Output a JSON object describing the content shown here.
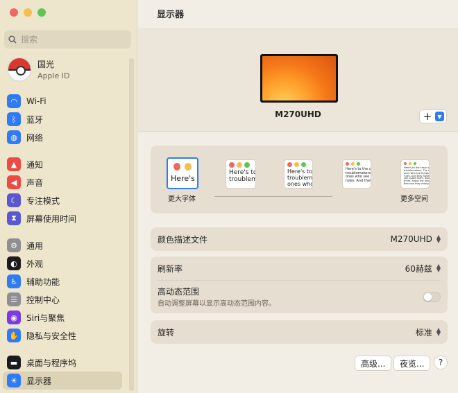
{
  "window": {
    "title": "显示器"
  },
  "search": {
    "placeholder": "搜索"
  },
  "profile": {
    "name": "国光",
    "subtitle": "Apple ID"
  },
  "sidebar": {
    "groups": [
      [
        {
          "label": "Wi-Fi",
          "icon": "wifi-icon",
          "color": "#2f7bf5",
          "glyph": "◠"
        },
        {
          "label": "蓝牙",
          "icon": "bluetooth-icon",
          "color": "#2f7bf5",
          "glyph": "ᛒ"
        },
        {
          "label": "网络",
          "icon": "globe-icon",
          "color": "#2f7bf5",
          "glyph": "◍"
        }
      ],
      [
        {
          "label": "通知",
          "icon": "bell-icon",
          "color": "#ec4b44",
          "glyph": "▲"
        },
        {
          "label": "声音",
          "icon": "speaker-icon",
          "color": "#ec4b44",
          "glyph": "◀"
        },
        {
          "label": "专注模式",
          "icon": "moon-icon",
          "color": "#5b57d1",
          "glyph": "☾"
        },
        {
          "label": "屏幕使用时间",
          "icon": "hourglass-icon",
          "color": "#5b57d1",
          "glyph": "⧗"
        }
      ],
      [
        {
          "label": "通用",
          "icon": "gear-icon",
          "color": "#8e8e93",
          "glyph": "⚙"
        },
        {
          "label": "外观",
          "icon": "appearance-icon",
          "color": "#1c1c1e",
          "glyph": "◐"
        },
        {
          "label": "辅助功能",
          "icon": "accessibility-icon",
          "color": "#2f7bf5",
          "glyph": "♿"
        },
        {
          "label": "控制中心",
          "icon": "control-center-icon",
          "color": "#8e8e93",
          "glyph": "☰"
        },
        {
          "label": "Siri与聚焦",
          "icon": "siri-icon",
          "color": "#7a3ce0",
          "glyph": "◉"
        },
        {
          "label": "隐私与安全性",
          "icon": "hand-icon",
          "color": "#2f7bf5",
          "glyph": "✋"
        }
      ],
      [
        {
          "label": "桌面与程序坞",
          "icon": "dock-icon",
          "color": "#1c1c1e",
          "glyph": "▬"
        },
        {
          "label": "显示器",
          "icon": "display-icon",
          "color": "#2f7bf5",
          "glyph": "☀",
          "active": true
        }
      ]
    ]
  },
  "display": {
    "name": "M270UHD",
    "add_label": "+"
  },
  "resolution": {
    "left_label": "更大字体",
    "right_label": "更多空间",
    "options": [
      {
        "text": "Here's",
        "selected": true
      },
      {
        "text": "Here's to\ntroublem"
      },
      {
        "text": "Here's to t\ntroublema\nones who"
      },
      {
        "text": "Here's to the c\ntroublemakers.\nones who see t\nrules. And they"
      },
      {
        "text": "Here's to the crazy one\ntroublemakers. The ro\nones who see things di\nrules. And they have n\ncan quote them, disagr\nthem. About the only th\nBecause they change th"
      }
    ]
  },
  "settings": {
    "color_profile": {
      "label": "颜色描述文件",
      "value": "M270UHD"
    },
    "refresh_rate": {
      "label": "刷新率",
      "value": "60赫兹"
    },
    "hdr": {
      "label": "高动态范围",
      "description": "自动调整屏幕以显示高动态范围内容。",
      "enabled": false
    },
    "rotation": {
      "label": "旋转",
      "value": "标准"
    }
  },
  "buttons": {
    "advanced": "高级...",
    "night_shift": "夜览...",
    "help": "?"
  }
}
